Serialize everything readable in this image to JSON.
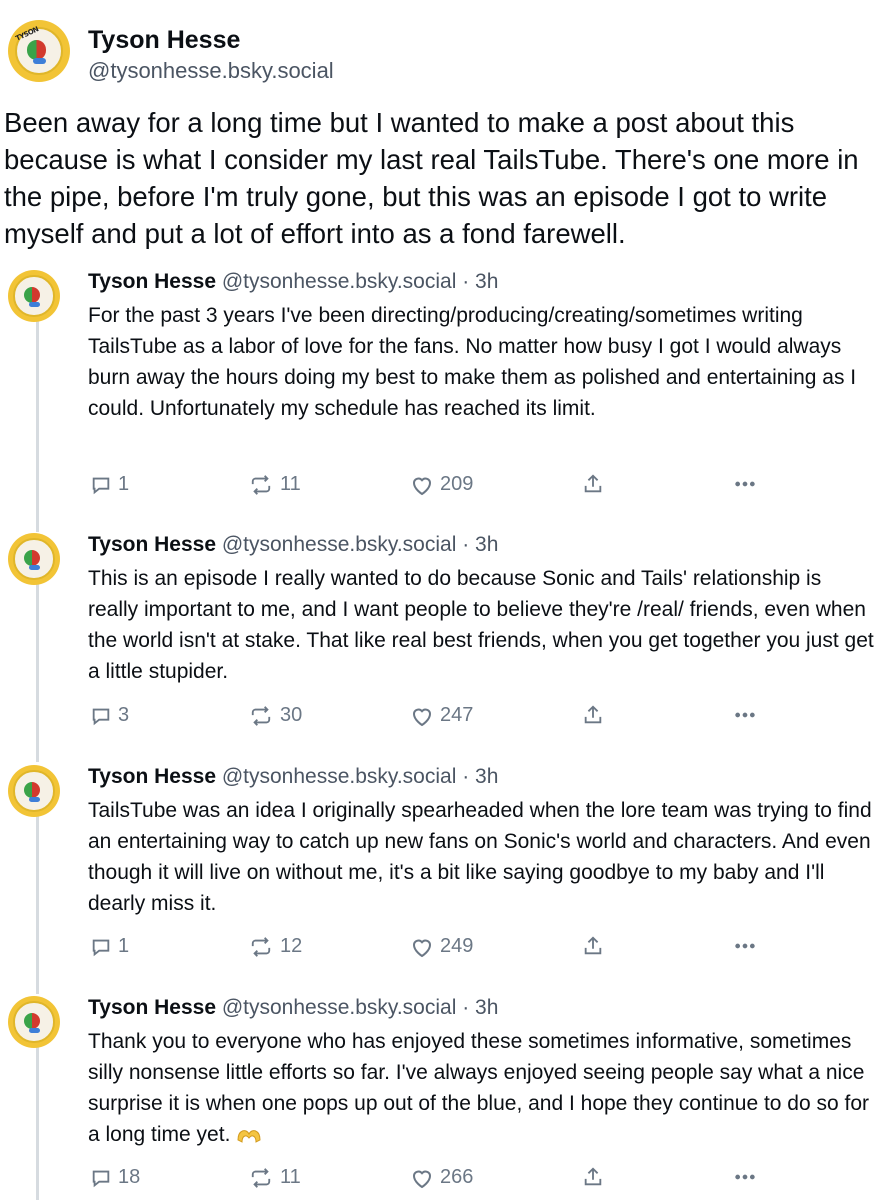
{
  "main_post": {
    "author_name": "Tyson Hesse",
    "handle": "@tysonhesse.bsky.social",
    "avatar_text": "TYSON",
    "text": "Been away for a long time but I wanted to make a post about this because is what I consider my last real TailsTube.  There's one more in the pipe, before I'm truly gone, but this was an episode I got to write myself and put a lot of effort into as a fond farewell."
  },
  "replies": [
    {
      "author_name": "Tyson Hesse",
      "handle": "@tysonhesse.bsky.social",
      "time": "· 3h",
      "text": "For the past 3 years I've been directing/producing/creating/sometimes writing TailsTube as a labor of love for the fans.  No matter how busy I got I would always burn away the hours doing my best to make them as polished and entertaining as I could.  Unfortunately my schedule has reached its limit.",
      "replies_count": "1",
      "reposts_count": "11",
      "likes_count": "209"
    },
    {
      "author_name": "Tyson Hesse",
      "handle": "@tysonhesse.bsky.social",
      "time": "· 3h",
      "text": "This is an episode I really wanted to do because Sonic and Tails' relationship is really important to me, and I want people to believe they're /real/ friends, even when the world isn't at stake.  That like real best friends, when you get together you just get a little stupider.",
      "replies_count": "3",
      "reposts_count": "30",
      "likes_count": "247"
    },
    {
      "author_name": "Tyson Hesse",
      "handle": "@tysonhesse.bsky.social",
      "time": "· 3h",
      "text": "TailsTube was an idea I originally spearheaded when the lore team was trying to find an entertaining way to catch up new fans on Sonic's world and characters.  And even though it will live on without me, it's a bit like saying goodbye to my baby and I'll dearly miss it.",
      "replies_count": "1",
      "reposts_count": "12",
      "likes_count": "249"
    },
    {
      "author_name": "Tyson Hesse",
      "handle": "@tysonhesse.bsky.social",
      "time": "· 3h",
      "text": "Thank you to everyone who has enjoyed these sometimes informative, sometimes silly nonsense little efforts so far.  I've always enjoyed seeing people say what a nice surprise it is when one pops up out of the blue, and I hope they continue to do so for a long time yet.",
      "emoji": "heart-hands",
      "replies_count": "18",
      "reposts_count": "11",
      "likes_count": "266"
    }
  ],
  "icons": {
    "reply": "speech-bubble-icon",
    "repost": "repost-arrows-icon",
    "like": "heart-outline-icon",
    "share": "share-upload-icon",
    "more": "ellipsis-icon"
  },
  "colors": {
    "muted": "#6b7785",
    "thread_line": "#d6dbe0",
    "avatar_ring": "#f2c436"
  }
}
